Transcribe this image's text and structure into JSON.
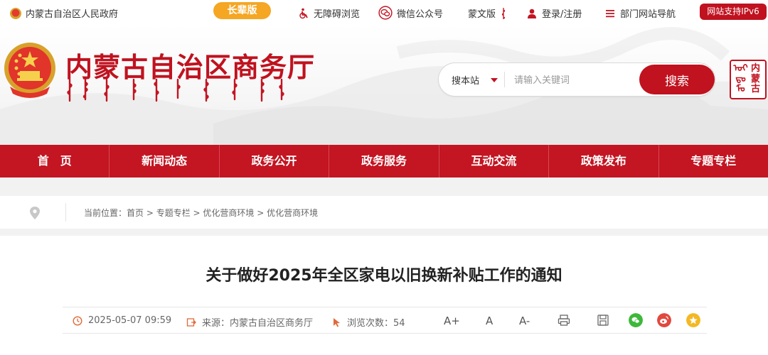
{
  "topbar": {
    "gov_link": "内蒙古自治区人民政府",
    "elder_mode": "长辈版",
    "accessibility": "无障碍浏览",
    "wechat": "微信公众号",
    "mongolian": "蒙文版",
    "login": "登录/注册",
    "dept_nav": "部门网站导航",
    "ipv6": "网站支持IPv6"
  },
  "header": {
    "site_title": "内蒙古自治区商务厅",
    "search": {
      "scope": "搜本站",
      "placeholder": "请输入关键词",
      "button": "搜索"
    },
    "seal_chars": [
      "ᠣᠶ",
      "内",
      "ᠳᠤ",
      "蒙",
      "ᠮᠤ",
      "古"
    ]
  },
  "nav": [
    "首　页",
    "新闻动态",
    "政务公开",
    "政务服务",
    "互动交流",
    "政策发布",
    "专题专栏"
  ],
  "breadcrumb": {
    "label": "当前位置：",
    "path": "首页 > 专题专栏 > 优化营商环境 > 优化营商环境"
  },
  "article": {
    "title": "关于做好2025年全区家电以旧换新补贴工作的通知",
    "date": "2025-05-07 09:59",
    "source_label": "来源：",
    "source": "内蒙古自治区商务厅",
    "views_label": "浏览次数：",
    "views": "54",
    "font_larger": "A+",
    "font_normal": "A",
    "font_smaller": "A-"
  },
  "colors": {
    "brand_red": "#c31522",
    "elder_orange": "#f5a623",
    "wechat_green": "#3db83a",
    "weibo_red": "#e2483d",
    "star_yellow": "#f3b824"
  }
}
